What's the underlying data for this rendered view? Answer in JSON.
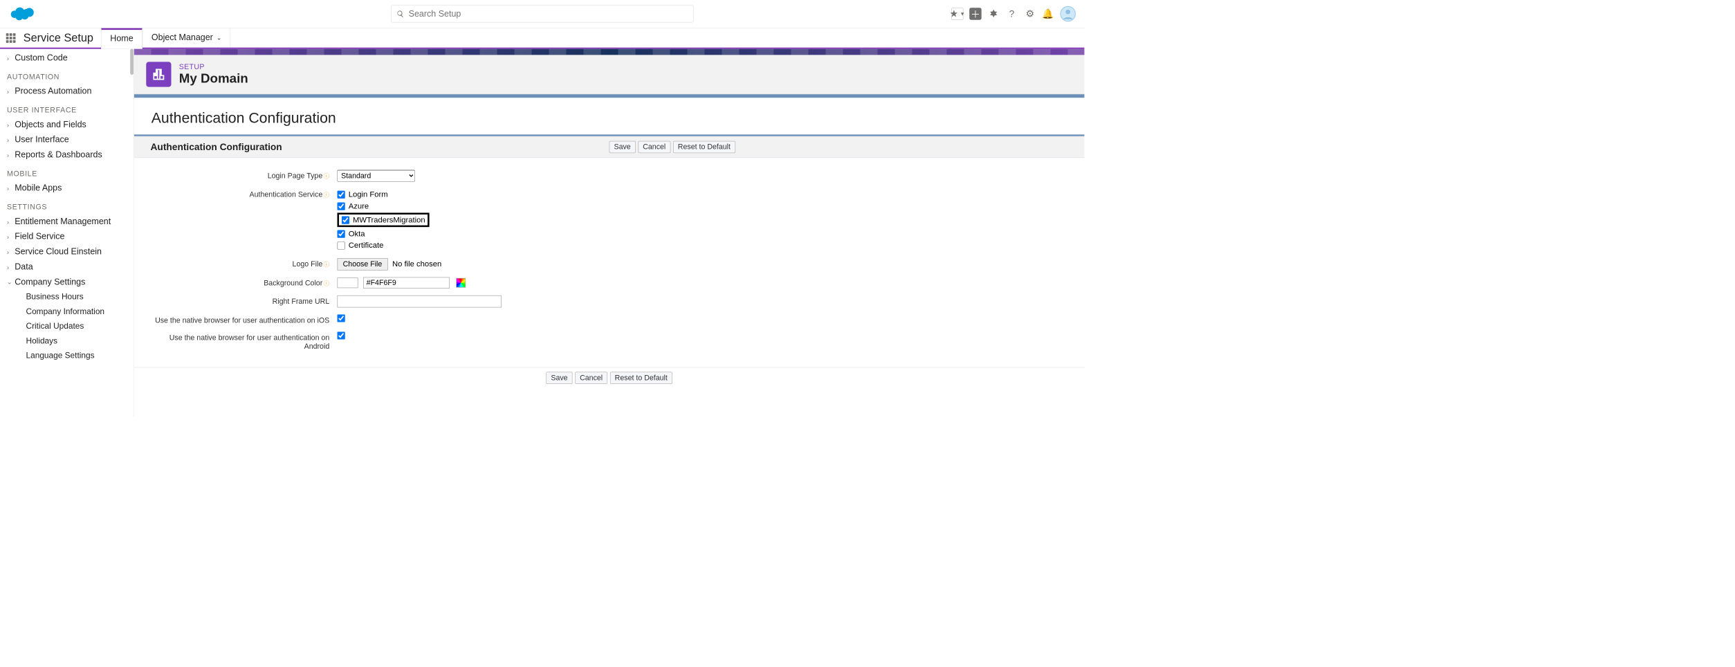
{
  "header": {
    "search_placeholder": "Search Setup"
  },
  "nav": {
    "brand": "Service Setup",
    "tabs": [
      {
        "label": "Home",
        "active": true
      },
      {
        "label": "Object Manager",
        "active": false
      }
    ]
  },
  "sidebar": {
    "items": [
      {
        "type": "item",
        "label": "Custom Code"
      },
      {
        "type": "head",
        "label": "AUTOMATION"
      },
      {
        "type": "item",
        "label": "Process Automation"
      },
      {
        "type": "head",
        "label": "USER INTERFACE"
      },
      {
        "type": "item",
        "label": "Objects and Fields"
      },
      {
        "type": "item",
        "label": "User Interface"
      },
      {
        "type": "item",
        "label": "Reports & Dashboards"
      },
      {
        "type": "head",
        "label": "MOBILE"
      },
      {
        "type": "item",
        "label": "Mobile Apps"
      },
      {
        "type": "head",
        "label": "SETTINGS"
      },
      {
        "type": "item",
        "label": "Entitlement Management"
      },
      {
        "type": "item",
        "label": "Field Service"
      },
      {
        "type": "item",
        "label": "Service Cloud Einstein"
      },
      {
        "type": "item",
        "label": "Data"
      },
      {
        "type": "item-open",
        "label": "Company Settings"
      },
      {
        "type": "child",
        "label": "Business Hours"
      },
      {
        "type": "child",
        "label": "Company Information"
      },
      {
        "type": "child",
        "label": "Critical Updates"
      },
      {
        "type": "child",
        "label": "Holidays"
      },
      {
        "type": "child",
        "label": "Language Settings"
      }
    ]
  },
  "page": {
    "eyebrow": "SETUP",
    "title": "My Domain",
    "section": "Authentication Configuration",
    "panel_title": "Authentication Configuration",
    "buttons": {
      "save": "Save",
      "cancel": "Cancel",
      "reset": "Reset to Default"
    },
    "fields": {
      "login_type_label": "Login Page Type",
      "login_type_value": "Standard",
      "auth_service_label": "Authentication Service",
      "auth_options": [
        {
          "label": "Login Form",
          "checked": true,
          "highlight": false
        },
        {
          "label": "Azure",
          "checked": true,
          "highlight": false
        },
        {
          "label": "MWTradersMigration",
          "checked": true,
          "highlight": true
        },
        {
          "label": "Okta",
          "checked": true,
          "highlight": false
        },
        {
          "label": "Certificate",
          "checked": false,
          "highlight": false
        }
      ],
      "logo_label": "Logo File",
      "logo_btn": "Choose File",
      "logo_status": "No file chosen",
      "bg_label": "Background Color",
      "bg_value": "#F4F6F9",
      "rframe_label": "Right Frame URL",
      "ios_label": "Use the native browser for user authentication on iOS",
      "android_label": "Use the native browser for user authentication on Android"
    }
  }
}
